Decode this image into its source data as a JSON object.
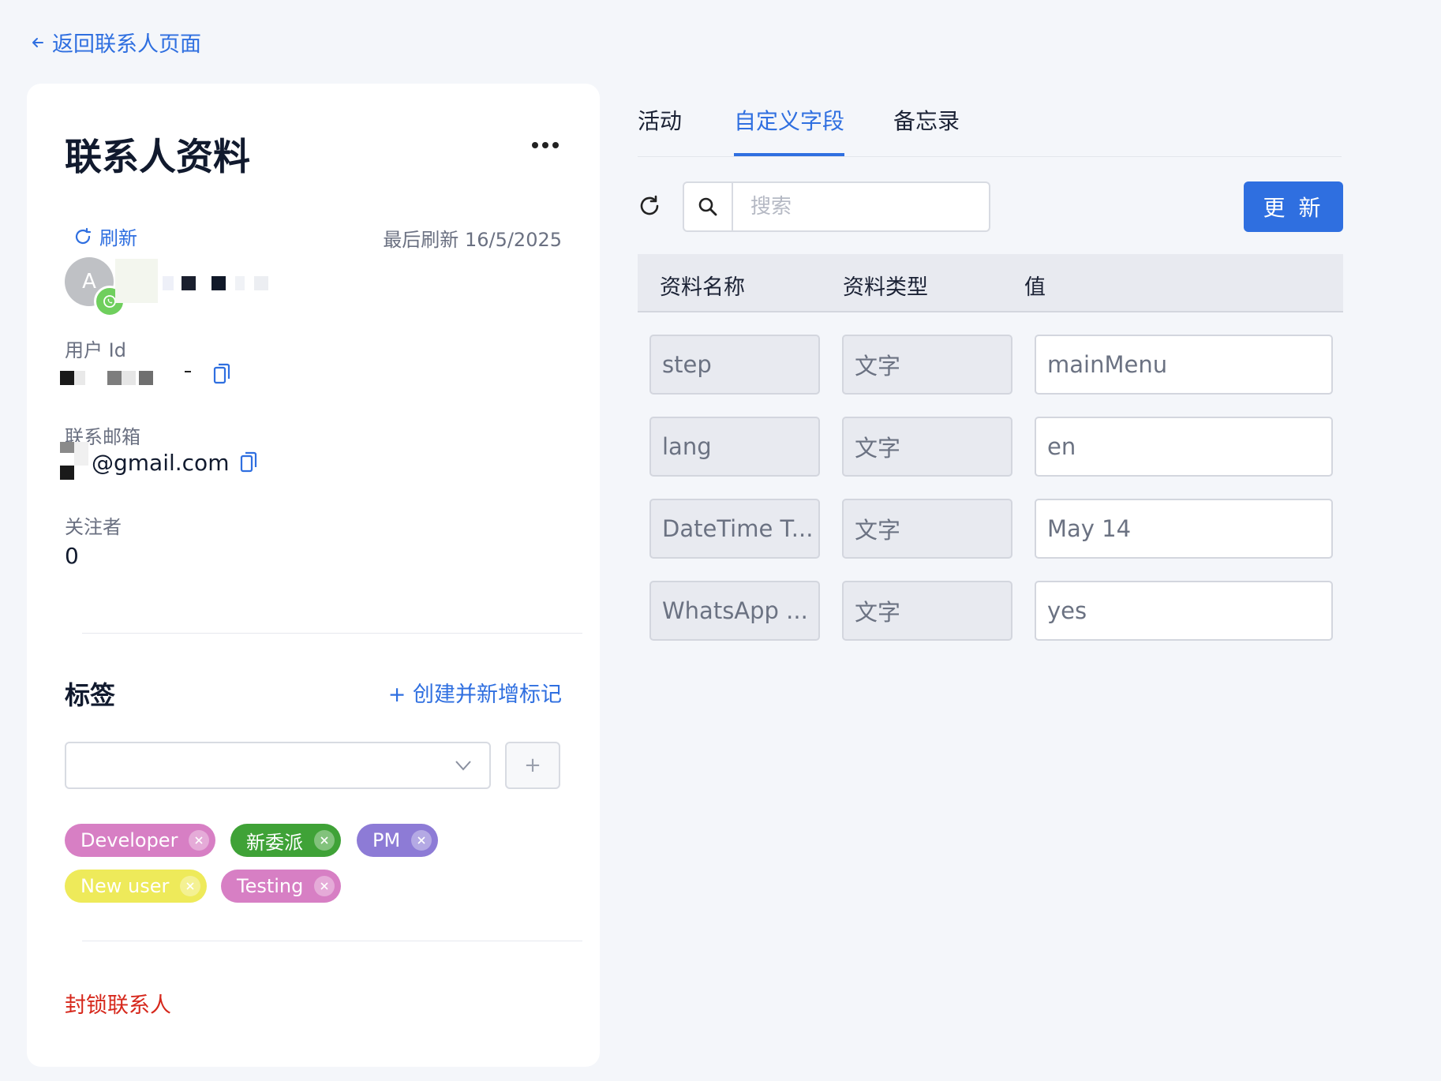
{
  "nav": {
    "back_label": "返回联系人页面"
  },
  "profile": {
    "title": "联系人资料",
    "refresh_label": "刷新",
    "last_refresh": "最后刷新 16/5/2025",
    "avatar_initial": "A",
    "user_id_label": "用户 Id",
    "email_label": "联系邮箱",
    "email_value": "@gmail.com",
    "followers_label": "关注者",
    "followers_value": "0",
    "tags_title": "标签",
    "create_tag_label": "+ 创建并新增标记",
    "add_button": "+",
    "tags": [
      {
        "label": "Developer",
        "color": "#d77fc4"
      },
      {
        "label": "新委派",
        "color": "#3fa237"
      },
      {
        "label": "PM",
        "color": "#8d7bd6"
      },
      {
        "label": "New user",
        "color": "#eeea5a"
      },
      {
        "label": "Testing",
        "color": "#d77fc4"
      }
    ],
    "block_label": "封锁联系人"
  },
  "tabs": [
    {
      "label": "活动",
      "active": false
    },
    {
      "label": "自定义字段",
      "active": true
    },
    {
      "label": "备忘录",
      "active": false
    }
  ],
  "toolbar": {
    "search_placeholder": "搜索",
    "update_label": "更 新"
  },
  "table": {
    "headers": [
      "资料名称",
      "资料类型",
      "值"
    ],
    "rows": [
      {
        "name": "step",
        "type": "文字",
        "value": "mainMenu"
      },
      {
        "name": "lang",
        "type": "文字",
        "value": "en"
      },
      {
        "name": "DateTime T...",
        "type": "文字",
        "value": "May 14"
      },
      {
        "name": "WhatsApp ...",
        "type": "文字",
        "value": "yes"
      }
    ]
  },
  "colors": {
    "accent": "#2f6fe0",
    "danger": "#d6281c",
    "whatsapp": "#6fcf5d"
  }
}
